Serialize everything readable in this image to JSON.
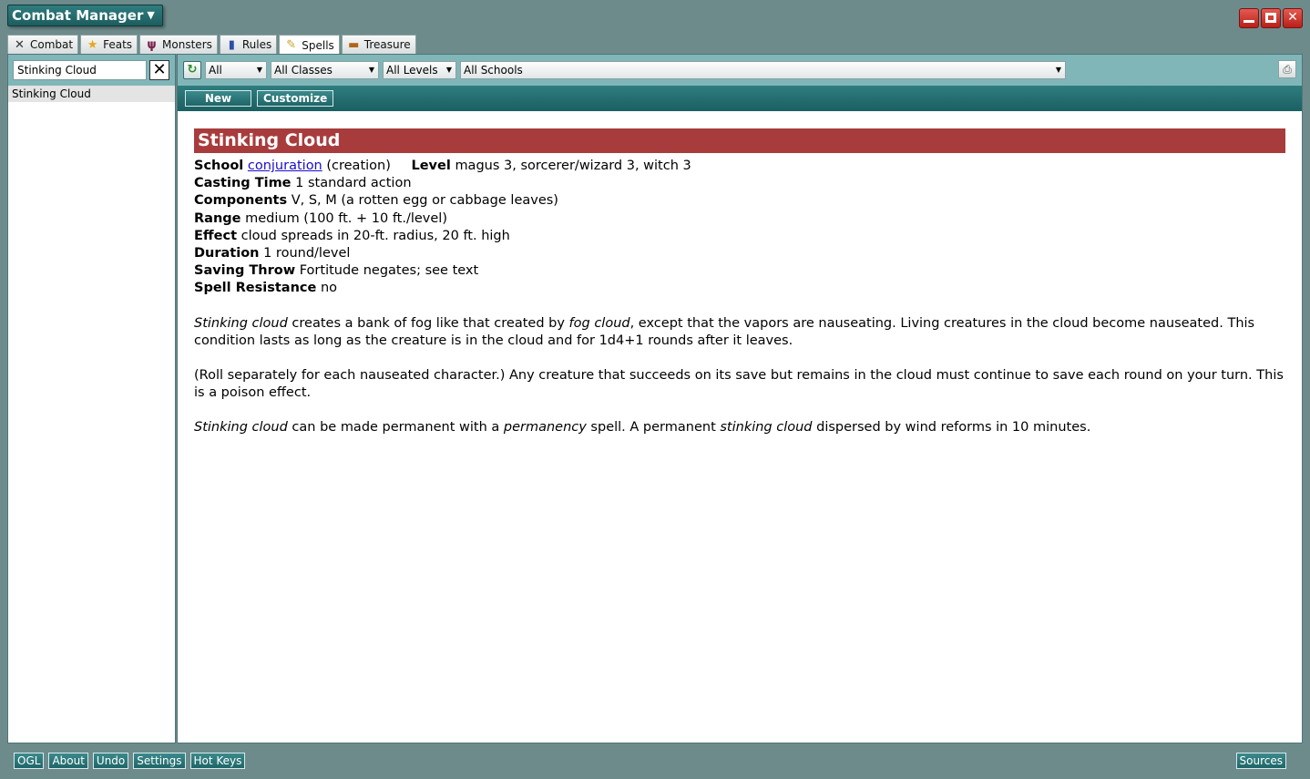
{
  "app": {
    "title": "Combat Manager",
    "menu_chevron": "▼"
  },
  "window_controls": {
    "close_label": "✕"
  },
  "tabs": [
    {
      "label": "Combat",
      "icon": "x-icon",
      "glyph": "✕"
    },
    {
      "label": "Feats",
      "icon": "star-icon",
      "glyph": "★"
    },
    {
      "label": "Monsters",
      "icon": "monster-icon",
      "glyph": "ψ"
    },
    {
      "label": "Rules",
      "icon": "book-icon",
      "glyph": "▮"
    },
    {
      "label": "Spells",
      "icon": "scroll-icon",
      "glyph": "✎"
    },
    {
      "label": "Treasure",
      "icon": "chest-icon",
      "glyph": "▬"
    }
  ],
  "active_tab": "Spells",
  "search": {
    "value": "Stinking Cloud",
    "clear_label": "✕"
  },
  "results": [
    "Stinking Cloud"
  ],
  "filters": {
    "refresh_glyph": "↻",
    "source": "All",
    "classes": "All Classes",
    "levels": "All Levels",
    "schools": "All Schools",
    "arrow": "▼",
    "print_glyph": "⎙"
  },
  "actions": {
    "new_label": "New",
    "customize_label": "Customize"
  },
  "spell": {
    "name": "Stinking Cloud",
    "school_label": "School",
    "school_link": "conjuration",
    "school_sub": "(creation)",
    "level_label": "Level",
    "level_value": "magus 3, sorcerer/wizard 3, witch 3",
    "casting_time_label": "Casting Time",
    "casting_time_value": "1 standard action",
    "components_label": "Components",
    "components_value": "V, S, M (a rotten egg or cabbage leaves)",
    "range_label": "Range",
    "range_value": "medium (100 ft. + 10 ft./level)",
    "effect_label": "Effect",
    "effect_value": "cloud spreads in 20-ft. radius, 20 ft. high",
    "duration_label": "Duration",
    "duration_value": "1 round/level",
    "saving_throw_label": "Saving Throw",
    "saving_throw_value": "Fortitude negates; see text",
    "spell_resistance_label": "Spell Resistance",
    "spell_resistance_value": "no",
    "p1_a": "Stinking cloud",
    "p1_b": " creates a bank of fog like that created by ",
    "p1_c": "fog cloud",
    "p1_d": ", except that the vapors are nauseating. Living creatures in the cloud become nauseated. This condition lasts as long as the creature is in the cloud and for 1d4+1 rounds after it leaves.",
    "p2": "(Roll separately for each nauseated character.) Any creature that succeeds on its save but remains in the cloud must continue to save each round on your turn. This is a poison effect.",
    "p3_a": "Stinking cloud",
    "p3_b": " can be made permanent with a ",
    "p3_c": "permanency",
    "p3_d": " spell. A permanent ",
    "p3_e": "stinking cloud",
    "p3_f": " dispersed by wind reforms in 10 minutes."
  },
  "bottom": {
    "ogl": "OGL",
    "about": "About",
    "undo": "Undo",
    "settings": "Settings",
    "hotkeys": "Hot Keys",
    "sources": "Sources"
  },
  "colors": {
    "background": "#6e8b8c",
    "accent_teal": "#1f6567",
    "filter_bar": "#81b6b9",
    "spell_header": "#a83c3d",
    "link": "#1a0dcc",
    "close_red": "#c8312a"
  }
}
